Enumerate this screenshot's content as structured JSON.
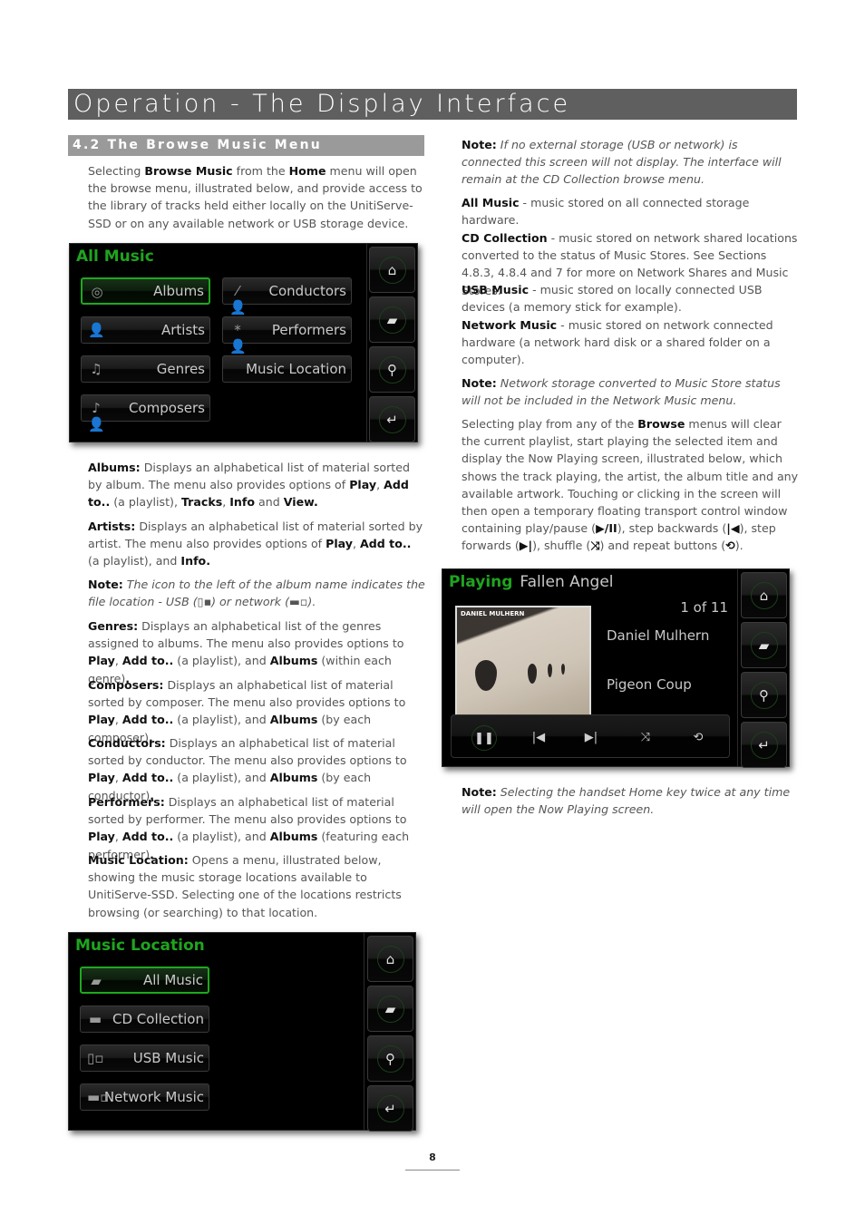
{
  "page": {
    "title": "Operation - The Display Interface",
    "section": "4.2 The Browse Music Menu",
    "page_number": "8"
  },
  "left_column": {
    "intro": [
      {
        "t": "Selecting "
      },
      {
        "b": "Browse Music"
      },
      {
        "t": " from the "
      },
      {
        "b": "Home"
      },
      {
        "t": " menu will open the browse menu, illustrated below, and provide access to the library of tracks held either locally on the UnitiServe-SSD or on any available network or USB storage device."
      }
    ],
    "descriptions": [
      [
        {
          "b": "Albums:"
        },
        {
          "t": " Displays an alphabetical list of material sorted by album. The menu also provides options of "
        },
        {
          "b": "Play"
        },
        {
          "t": ", "
        },
        {
          "b": "Add to.."
        },
        {
          "t": " (a playlist), "
        },
        {
          "b": "Tracks"
        },
        {
          "t": ", "
        },
        {
          "b": "Info"
        },
        {
          "t": " and "
        },
        {
          "b": "View."
        }
      ],
      [
        {
          "b": "Artists:"
        },
        {
          "t": " Displays an alphabetical list of material sorted by artist. The menu also provides options of "
        },
        {
          "b": "Play"
        },
        {
          "t": ", "
        },
        {
          "b": "Add to.."
        },
        {
          "t": " (a playlist), and "
        },
        {
          "b": "Info."
        }
      ],
      [
        {
          "b": "Note:"
        },
        {
          "i": " The icon to the left of the album name indicates the file location - USB (▯▪) or network (▬▫)."
        }
      ],
      [
        {
          "b": "Genres:"
        },
        {
          "t": " Displays an alphabetical list of the genres assigned to albums. The menu also provides options to "
        },
        {
          "b": "Play"
        },
        {
          "t": ", "
        },
        {
          "b": "Add to.."
        },
        {
          "t": " (a playlist), and "
        },
        {
          "b": "Albums"
        },
        {
          "t": " (within each genre)"
        },
        {
          "b": "."
        }
      ],
      [
        {
          "b": "Composers:"
        },
        {
          "t": " Displays an alphabetical list of material sorted by composer. The menu also provides options to "
        },
        {
          "b": "Play"
        },
        {
          "t": ", "
        },
        {
          "b": "Add to.."
        },
        {
          "t": " (a playlist), and "
        },
        {
          "b": "Albums"
        },
        {
          "t": " (by each composer)"
        },
        {
          "b": "."
        }
      ],
      [
        {
          "b": "Conductors:"
        },
        {
          "t": " Displays an alphabetical list of material sorted by conductor. The menu also provides options to "
        },
        {
          "b": "Play"
        },
        {
          "t": ", "
        },
        {
          "b": "Add to.."
        },
        {
          "t": " (a playlist), and "
        },
        {
          "b": "Albums"
        },
        {
          "t": " (by each conductor)"
        },
        {
          "b": "."
        }
      ],
      [
        {
          "b": "Performers:"
        },
        {
          "t": " Displays an alphabetical list of material sorted by performer. The menu also provides options to "
        },
        {
          "b": "Play"
        },
        {
          "t": ", "
        },
        {
          "b": "Add to.."
        },
        {
          "t": " (a playlist), and "
        },
        {
          "b": "Albums"
        },
        {
          "t": " (featuring each performer)"
        },
        {
          "b": "."
        }
      ],
      [
        {
          "b": "Music Location:"
        },
        {
          "t": " Opens a menu, illustrated below, showing the music storage locations available to UnitiServe-SSD. Selecting one of the locations restricts browsing (or searching) to that location."
        }
      ]
    ]
  },
  "right_column": {
    "note1": [
      {
        "b": "Note:"
      },
      {
        "i": " If no external storage (USB or network) is connected this screen will not display. The interface will remain at the CD Collection browse menu."
      }
    ],
    "locations": [
      [
        {
          "b": "All Music"
        },
        {
          "t": " - music stored on all connected storage hardware."
        }
      ],
      [
        {
          "b": "CD Collection"
        },
        {
          "t": " - music stored on network shared locations converted to the status of Music Stores. See Sections 4.8.3, 4.8.4 and 7 for more on Network Shares and Music Stores."
        }
      ],
      [
        {
          "b": "USB Music"
        },
        {
          "t": " - music stored on locally connected USB devices (a memory stick for example)."
        }
      ],
      [
        {
          "b": "Network Music"
        },
        {
          "t": " - music stored on network connected hardware (a network hard disk or a shared folder on a computer)."
        }
      ]
    ],
    "note2": [
      {
        "b": "Note:"
      },
      {
        "i": " Network storage converted to Music Store status will not be included in the Network Music menu."
      }
    ],
    "playing_para": [
      {
        "t": "Selecting play from any of the "
      },
      {
        "b": "Browse"
      },
      {
        "t": " menus will clear the current playlist, start playing the selected item and display the Now Playing screen, illustrated below, which shows the track playing, the artist, the album title and any available artwork. Touching or clicking in the screen will then open a temporary floating transport control window containing play/pause ("
      },
      {
        "b": "▶/II"
      },
      {
        "t": "), step backwards ("
      },
      {
        "b": "|◀"
      },
      {
        "t": "), step forwards ("
      },
      {
        "b": "▶|"
      },
      {
        "t": "), shuffle ("
      },
      {
        "b": "⤨"
      },
      {
        "t": ") and repeat buttons ("
      },
      {
        "b": "⟲"
      },
      {
        "t": ")."
      }
    ],
    "note3": [
      {
        "b": "Note:"
      },
      {
        "i": " Selecting the handset Home key twice at any time will open the Now Playing screen."
      }
    ]
  },
  "screens": {
    "all_music": {
      "title": "All Music",
      "buttons": [
        {
          "label": "Albums",
          "icon": "cd-icon",
          "glyph": "◎",
          "selected": true
        },
        {
          "label": "Conductors",
          "icon": "conductor-icon",
          "glyph": "⁄👤",
          "selected": false
        },
        {
          "label": "Artists",
          "icon": "person-icon",
          "glyph": "👤",
          "selected": false
        },
        {
          "label": "Performers",
          "icon": "performer-icon",
          "glyph": "*👤",
          "selected": false
        },
        {
          "label": "Genres",
          "icon": "music-note-icon",
          "glyph": "♫",
          "selected": false
        },
        {
          "label": "Music Location",
          "icon": "",
          "glyph": "",
          "selected": false
        },
        {
          "label": "Composers",
          "icon": "composer-icon",
          "glyph": "♪👤",
          "selected": false
        }
      ]
    },
    "music_location": {
      "title": "Music Location",
      "buttons": [
        {
          "label": "All Music",
          "icon": "albums-stack-icon",
          "glyph": "▰",
          "selected": true
        },
        {
          "label": "CD Collection",
          "icon": "cd-drive-icon",
          "glyph": "▬",
          "selected": false
        },
        {
          "label": "USB Music",
          "icon": "usb-icon",
          "glyph": "▯▫",
          "selected": false
        },
        {
          "label": "Network Music",
          "icon": "network-icon",
          "glyph": "▬▫",
          "selected": false
        }
      ]
    },
    "now_playing": {
      "status": "Playing",
      "track": "Fallen Angel",
      "position": "1 of 11",
      "artist": "Daniel Mulhern",
      "album": "Pigeon Coup",
      "art_text": "DANIEL MULHERN",
      "transport": [
        {
          "name": "pause",
          "glyph": "❚❚"
        },
        {
          "name": "previous",
          "glyph": "|◀"
        },
        {
          "name": "next",
          "glyph": "▶|"
        },
        {
          "name": "shuffle",
          "glyph": "⤨"
        },
        {
          "name": "repeat",
          "glyph": "⟲"
        }
      ]
    },
    "side_buttons": [
      {
        "name": "home",
        "glyph": "⌂"
      },
      {
        "name": "browse",
        "glyph": "▰"
      },
      {
        "name": "search",
        "glyph": "⚲"
      },
      {
        "name": "back",
        "glyph": "↵"
      }
    ]
  },
  "colors": {
    "accent_green": "#1fa41f",
    "title_bar": "#5f5f5f",
    "section_bar": "#9a9a9a"
  }
}
